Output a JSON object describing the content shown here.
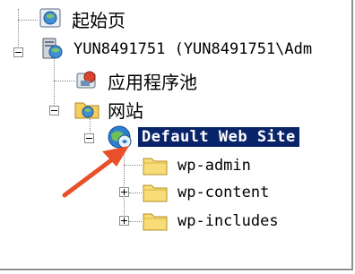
{
  "tree": {
    "start_page": "起始页",
    "server": "YUN8491751  (YUN8491751\\Adm",
    "app_pools": "应用程序池",
    "sites": "网站",
    "default_site": "Default Web Site",
    "folders": [
      "wp-admin",
      "wp-content",
      "wp-includes"
    ]
  },
  "colors": {
    "selection": "#0a246a",
    "arrow": "#e8502a",
    "folder": "#f5d76e"
  }
}
